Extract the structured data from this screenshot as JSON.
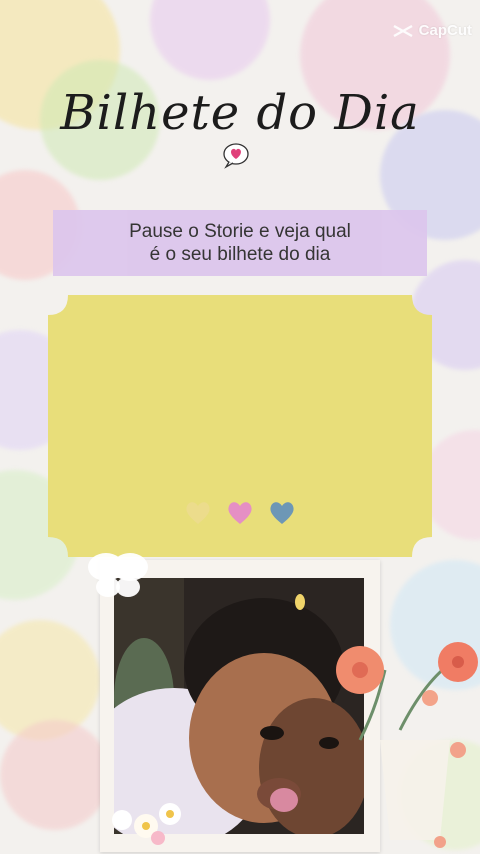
{
  "watermark": {
    "label": "CapCut",
    "icon": "capcut-logo-icon"
  },
  "header": {
    "title": "Bilhete do Dia",
    "title_icon": "speech-bubble-heart-icon"
  },
  "note": {
    "line1": "Pause o Storie e veja qual",
    "line2": "é o seu bilhete do dia"
  },
  "ticket": {
    "color": "#e8de7a",
    "hearts": [
      {
        "icon": "heart-icon",
        "color": "#e9d98c"
      },
      {
        "icon": "heart-icon",
        "color": "#e58fc4"
      },
      {
        "icon": "heart-icon",
        "color": "#6d97b6"
      }
    ]
  },
  "photo": {
    "icon": "child-photo"
  },
  "colors": {
    "accent_purple": "#dcc6ec",
    "ticket_yellow": "#e8de7a"
  }
}
